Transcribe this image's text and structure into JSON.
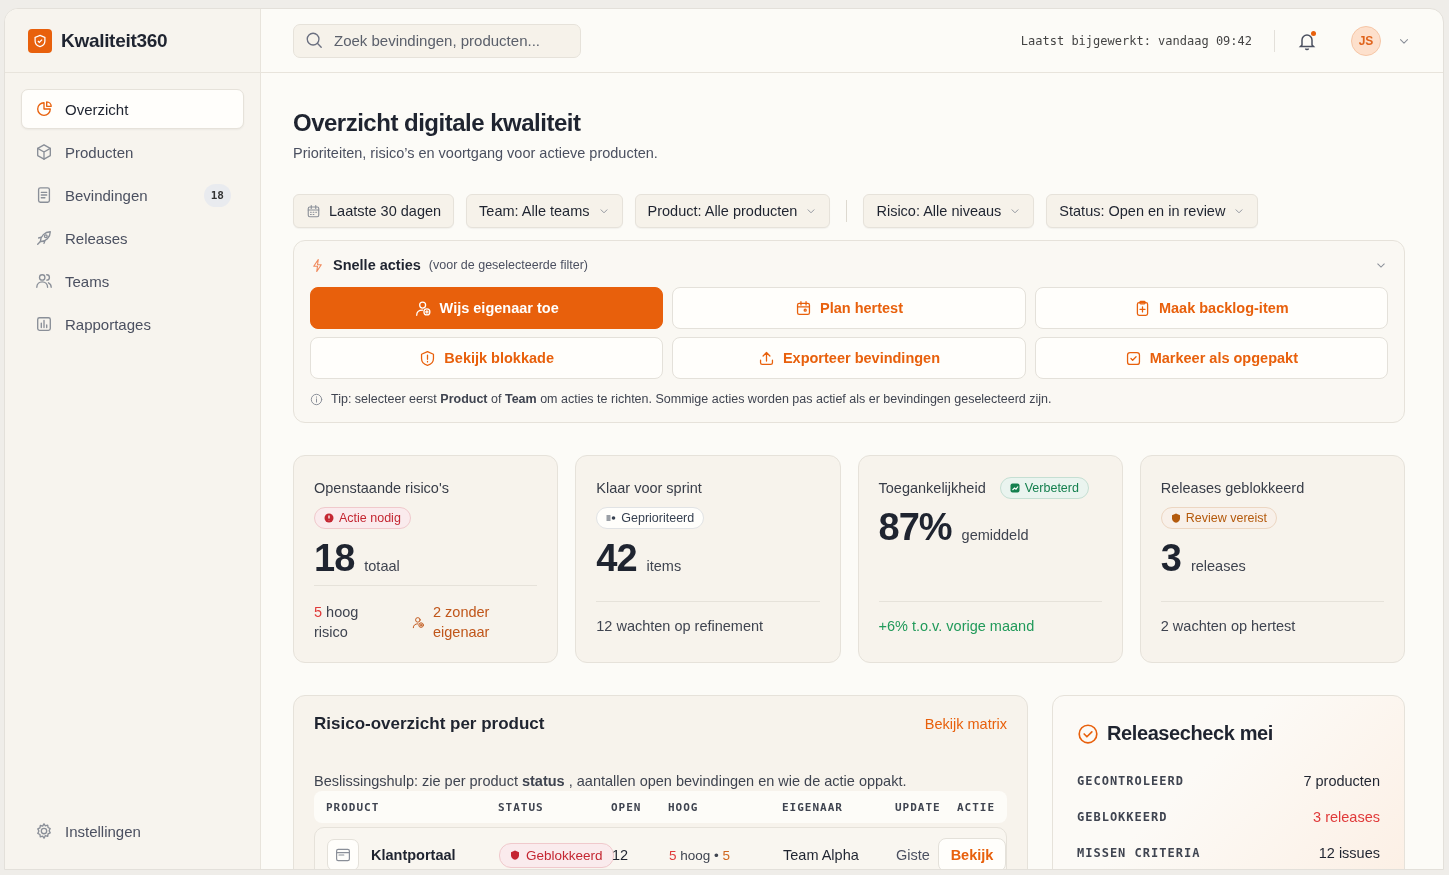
{
  "app": {
    "name": "Kwaliteit360"
  },
  "sidebar": {
    "items": [
      {
        "label": "Overzicht",
        "kind": "pie",
        "selected": true
      },
      {
        "label": "Producten",
        "kind": "box",
        "selected": false
      },
      {
        "label": "Bevindingen",
        "kind": "doc",
        "selected": false,
        "count": "18"
      },
      {
        "label": "Releases",
        "kind": "rocket",
        "selected": false
      },
      {
        "label": "Teams",
        "kind": "people",
        "selected": false
      },
      {
        "label": "Rapportages",
        "kind": "chart",
        "selected": false
      }
    ],
    "footer": {
      "label": "Instellingen",
      "kind": "gear"
    }
  },
  "header": {
    "search": {
      "placeholder": "Zoek bevindingen, producten..."
    },
    "updated": "Laatst bijgewerkt: vandaag 09:42",
    "notifications_unread": true,
    "avatar": "JS"
  },
  "page": {
    "title": "Overzicht digitale kwaliteit",
    "subtitle": "Prioriteiten, risico’s en voortgang voor actieve producten."
  },
  "filter_groups": [
    [
      {
        "label": "Laatste 30 dagen",
        "kind": "date"
      },
      {
        "label": "Team: Alle teams",
        "kind": "dropdown"
      },
      {
        "label": "Product: Alle producten",
        "kind": "dropdown"
      }
    ],
    [
      {
        "label": "Risico: Alle niveaus",
        "kind": "dropdown"
      },
      {
        "label": "Status: Open en in review",
        "kind": "dropdown"
      }
    ]
  ],
  "quick_actions": {
    "title": "Snelle acties",
    "note": "(voor de geselecteerde filter)",
    "expanded": true,
    "actions": [
      {
        "label": "Wijs eigenaar toe",
        "kind": "person",
        "primary": true
      },
      {
        "label": "Plan hertest",
        "kind": "calendar",
        "primary": false
      },
      {
        "label": "Maak backlog-item",
        "kind": "clipboard",
        "primary": false
      },
      {
        "label": "Bekijk blokkade",
        "kind": "shield",
        "primary": false
      },
      {
        "label": "Exporteer bevindingen",
        "kind": "upload",
        "primary": false
      },
      {
        "label": "Markeer als opgepakt",
        "kind": "check",
        "primary": false
      }
    ],
    "tip": "Tip: selecteer eerst **Product** of **Team** om acties te richten. Sommige acties worden pas actief als er bevindingen geselecteerd zijn."
  },
  "kpis": [
    {
      "title": "Openstaande risico's",
      "badge": {
        "label": "Actie nodig",
        "color": "#c42632",
        "inline": false
      },
      "value": "18",
      "unit": "totaal",
      "footer": [
        {
          "count": "5",
          "text": "hoog risico",
          "kind": "count"
        },
        {
          "text": "2 zonder eigenaar",
          "kind": "owner"
        }
      ]
    },
    {
      "title": "Klaar voor sprint",
      "badge": {
        "label": "Geprioriteerd",
        "color": "#374151",
        "inline": false
      },
      "value": "42",
      "unit": "items",
      "footer": [
        {
          "text": "12 wachten op refinement",
          "kind": "plain"
        }
      ]
    },
    {
      "title": "Toegankelijkheid",
      "badge": {
        "label": "Verbeterd",
        "color": "#15804f",
        "inline": true
      },
      "value": "87%",
      "unit": "gemiddeld",
      "footer": [
        {
          "text": "+6% t.o.v. vorige maand",
          "kind": "positive"
        }
      ]
    },
    {
      "title": "Releases geblokkeerd",
      "badge": {
        "label": "Review vereist",
        "color": "#b45a0c",
        "inline": false
      },
      "value": "3",
      "unit": "releases",
      "footer": [
        {
          "text": "2 wachten op hertest",
          "kind": "plain"
        }
      ]
    }
  ],
  "risk_table": {
    "title": "Risico-overzicht per product",
    "link": "Bekijk matrix",
    "help": "Beslissingshulp: zie per product **status** , aantallen open bevindingen en wie de actie oppakt.",
    "columns": [
      "PRODUCT",
      "STATUS",
      "OPEN",
      "HOOG",
      "EIGENAAR",
      "UPDATE",
      "ACTIE"
    ],
    "rows": [
      {
        "product": "Klantportaal",
        "status": {
          "label": "Geblokkeerd",
          "color": "#c42632"
        },
        "open": "12",
        "high": [
          {
            "text": "5",
            "color": "#e03a3a"
          },
          {
            "text": " hoog • "
          },
          {
            "text": "5",
            "color": "#d0671d"
          }
        ],
        "owner": "Team Alpha",
        "update": "Giste",
        "action": "Bekijk"
      }
    ]
  },
  "release_check": {
    "title": "Releasecheck mei",
    "rows": [
      {
        "label": "GECONTROLEERD",
        "value": "7 producten",
        "color": "#1f2430"
      },
      {
        "label": "GEBLOKKEERD",
        "value": "3 releases",
        "color": "#e03a3a"
      },
      {
        "label": "MISSEN CRITERIA",
        "value": "12 issues",
        "color": "#1f2430"
      }
    ]
  }
}
